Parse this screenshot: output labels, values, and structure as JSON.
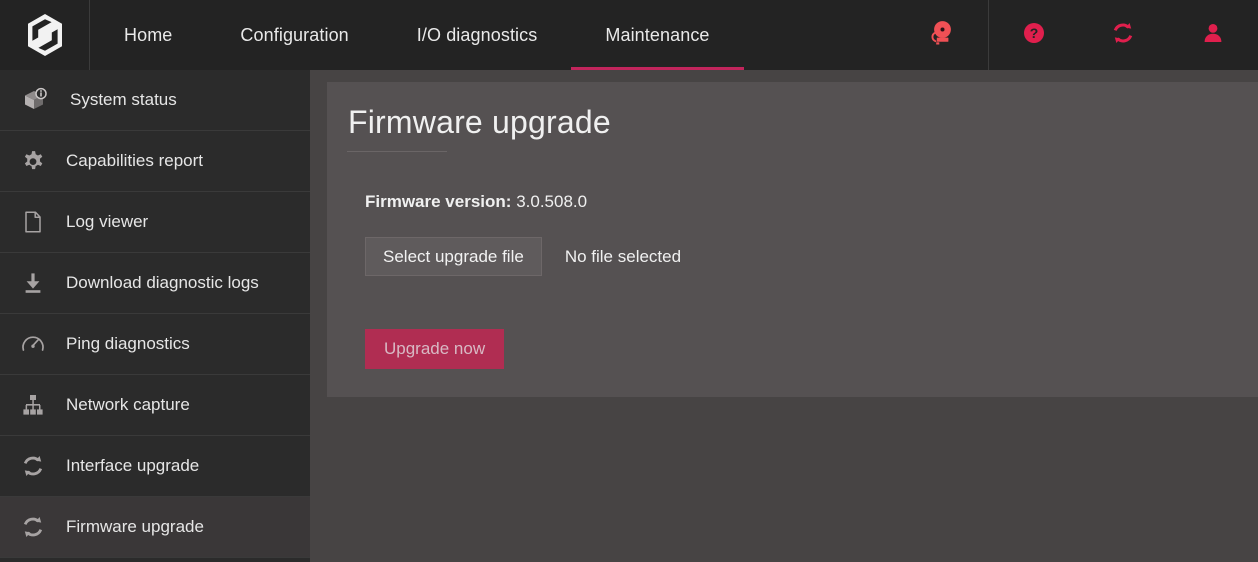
{
  "header": {
    "logo_name": "hexagon-swirl-logo",
    "nav": [
      {
        "label": "Home",
        "active": false
      },
      {
        "label": "Configuration",
        "active": false
      },
      {
        "label": "I/O diagnostics",
        "active": false
      },
      {
        "label": "Maintenance",
        "active": true
      }
    ],
    "icons": [
      {
        "name": "alarm-bell-icon",
        "label": "Alarms"
      },
      {
        "name": "help-icon",
        "label": "Help"
      },
      {
        "name": "refresh-icon",
        "label": "Refresh"
      },
      {
        "name": "user-icon",
        "label": "Account"
      }
    ]
  },
  "sidebar": {
    "items": [
      {
        "label": "System status",
        "icon": "package-info-icon",
        "active": false
      },
      {
        "label": "Capabilities report",
        "icon": "gear-icon",
        "active": false
      },
      {
        "label": "Log viewer",
        "icon": "document-icon",
        "active": false
      },
      {
        "label": "Download diagnostic logs",
        "icon": "download-icon",
        "active": false
      },
      {
        "label": "Ping diagnostics",
        "icon": "gauge-icon",
        "active": false
      },
      {
        "label": "Network capture",
        "icon": "sitemap-icon",
        "active": false
      },
      {
        "label": "Interface upgrade",
        "icon": "refresh-icon",
        "active": false
      },
      {
        "label": "Firmware upgrade",
        "icon": "refresh-icon",
        "active": true
      }
    ]
  },
  "main": {
    "title": "Firmware upgrade",
    "firmware_version_label": "Firmware version:",
    "firmware_version_value": "3.0.508.0",
    "select_file_button": "Select upgrade file",
    "file_status": "No file selected",
    "upgrade_button": "Upgrade now"
  },
  "colors": {
    "accent": "#c2255c",
    "accent_button": "#b02d52",
    "topbar_bg": "#232323",
    "sidebar_bg": "#2b2b2b",
    "sidebar_active_bg": "#3a3738",
    "main_bg": "#474444",
    "card_bg": "#555152"
  }
}
